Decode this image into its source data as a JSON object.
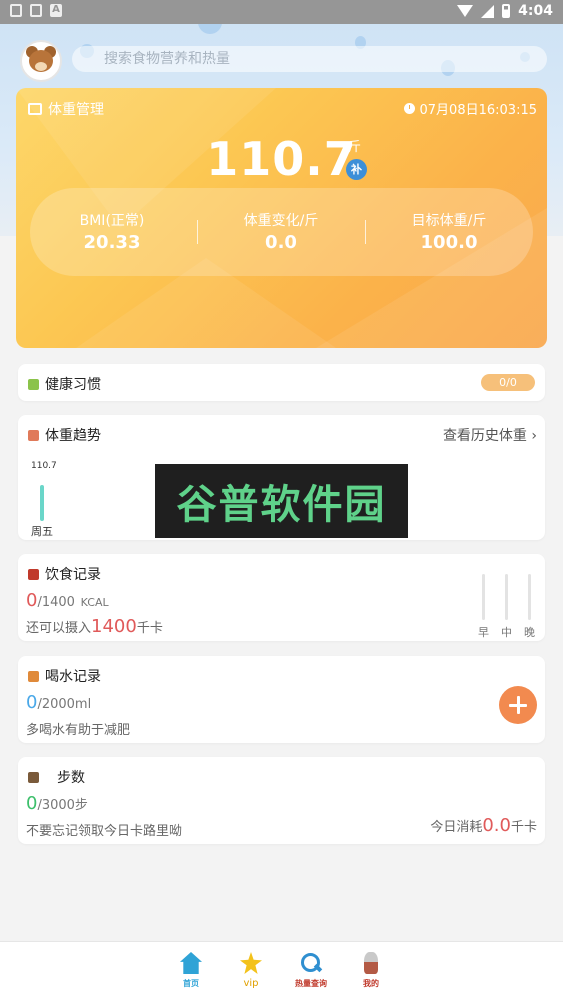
{
  "status_bar": {
    "time": "4:04",
    "left_icons": [
      "settings-icon",
      "sim-icon",
      "a-icon"
    ],
    "right_icons": [
      "wifi-icon",
      "signal-icon",
      "battery-icon"
    ]
  },
  "search": {
    "placeholder": "搜索食物营养和热量"
  },
  "weight_card": {
    "title": "体重管理",
    "datetime": "07月08日16:03:15",
    "weight": "110.7",
    "unit": "斤",
    "bu_badge": "补",
    "stats": [
      {
        "label": "BMI(正常)",
        "value": "20.33"
      },
      {
        "label": "体重变化/斤",
        "value": "0.0"
      },
      {
        "label": "目标体重/斤",
        "value": "100.0"
      }
    ]
  },
  "habits": {
    "title": "健康习惯",
    "progress": "0/0"
  },
  "trend": {
    "title": "体重趋势",
    "history_link": "查看历史体重",
    "point_value": "110.7",
    "point_day": "周五",
    "watermark": "谷普软件园"
  },
  "diet": {
    "title": "饮食记录",
    "eaten": "0",
    "budget": "/1400",
    "unit": "KCAL",
    "remain_prefix": "还可以摄入",
    "remain_value": "1400",
    "remain_unit": "千卡",
    "meals": [
      "早",
      "中",
      "晚"
    ]
  },
  "water": {
    "title": "喝水记录",
    "drunk": "0",
    "goal": "/2000ml",
    "tip": "多喝水有助于减肥"
  },
  "steps": {
    "title": "步数",
    "count": "0",
    "goal": "/3000步",
    "tip": "不要忘记领取今日卡路里呦",
    "burn_prefix": "今日消耗",
    "burn_value": "0.0",
    "burn_unit": "千卡"
  },
  "nav": [
    {
      "label": "首页",
      "icon": "home-icon",
      "color": "#2fa3d6"
    },
    {
      "label": "vip",
      "icon": "vip-icon",
      "color": "#e0a000"
    },
    {
      "label": "热量查询",
      "icon": "search-icon",
      "color": "#c0392b"
    },
    {
      "label": "我的",
      "icon": "profile-icon",
      "color": "#c0392b"
    }
  ],
  "colors": {
    "accent_red": "#e05a5a",
    "water_blue": "#4aa8e8",
    "steps_green": "#3cbf6b",
    "card_orange": "#fbb24a",
    "plus_orange": "#f28a4f"
  }
}
